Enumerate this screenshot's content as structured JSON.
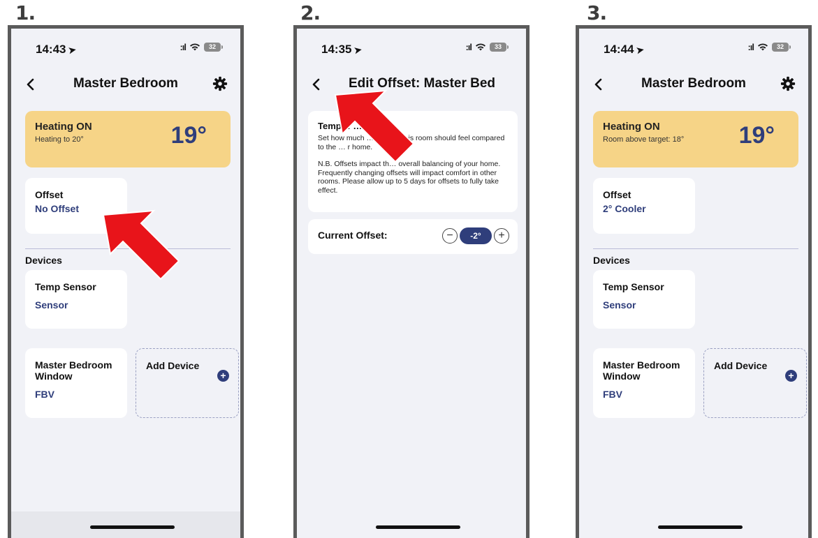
{
  "steps": [
    "1.",
    "2.",
    "3."
  ],
  "status": {
    "time1": "14:43",
    "time2": "14:35",
    "time3": "14:44",
    "battery1": "32",
    "battery2": "33",
    "battery3": "32"
  },
  "screen1": {
    "title": "Master Bedroom",
    "heating_title": "Heating ON",
    "heating_sub": "Heating to 20°",
    "temperature": "19°",
    "offset_label": "Offset",
    "offset_value": "No Offset",
    "devices_heading": "Devices",
    "device1_name": "Temp Sensor",
    "device1_type": "Sensor",
    "device2_name": "Master Bedroom Window",
    "device2_type": "FBV",
    "add_device": "Add Device"
  },
  "screen2": {
    "title": "Edit Offset: Master Bed",
    "info_heading": "Temp… …ffsets",
    "info_p1": "Set how much … r cooler this room should feel compared to the … r home.",
    "info_p2": "N.B. Offsets impact th… overall balancing of your home. Frequently changing offsets will impact comfort in other rooms. Please allow up to 5 days for offsets to fully take effect.",
    "current_offset_label": "Current Offset:",
    "offset_value": "-2°",
    "minus": "−",
    "plus": "+"
  },
  "screen3": {
    "title": "Master Bedroom",
    "heating_title": "Heating ON",
    "heating_sub": "Room above target: 18°",
    "temperature": "19°",
    "offset_label": "Offset",
    "offset_value": "2° Cooler",
    "devices_heading": "Devices",
    "device1_name": "Temp Sensor",
    "device1_type": "Sensor",
    "device2_name": "Master Bedroom Window",
    "device2_type": "FBV",
    "add_device": "Add Device"
  },
  "colors": {
    "accent": "#2f3e7b",
    "heating_card": "#f6d487",
    "background": "#f1f2f7",
    "arrow": "#e8141a"
  }
}
